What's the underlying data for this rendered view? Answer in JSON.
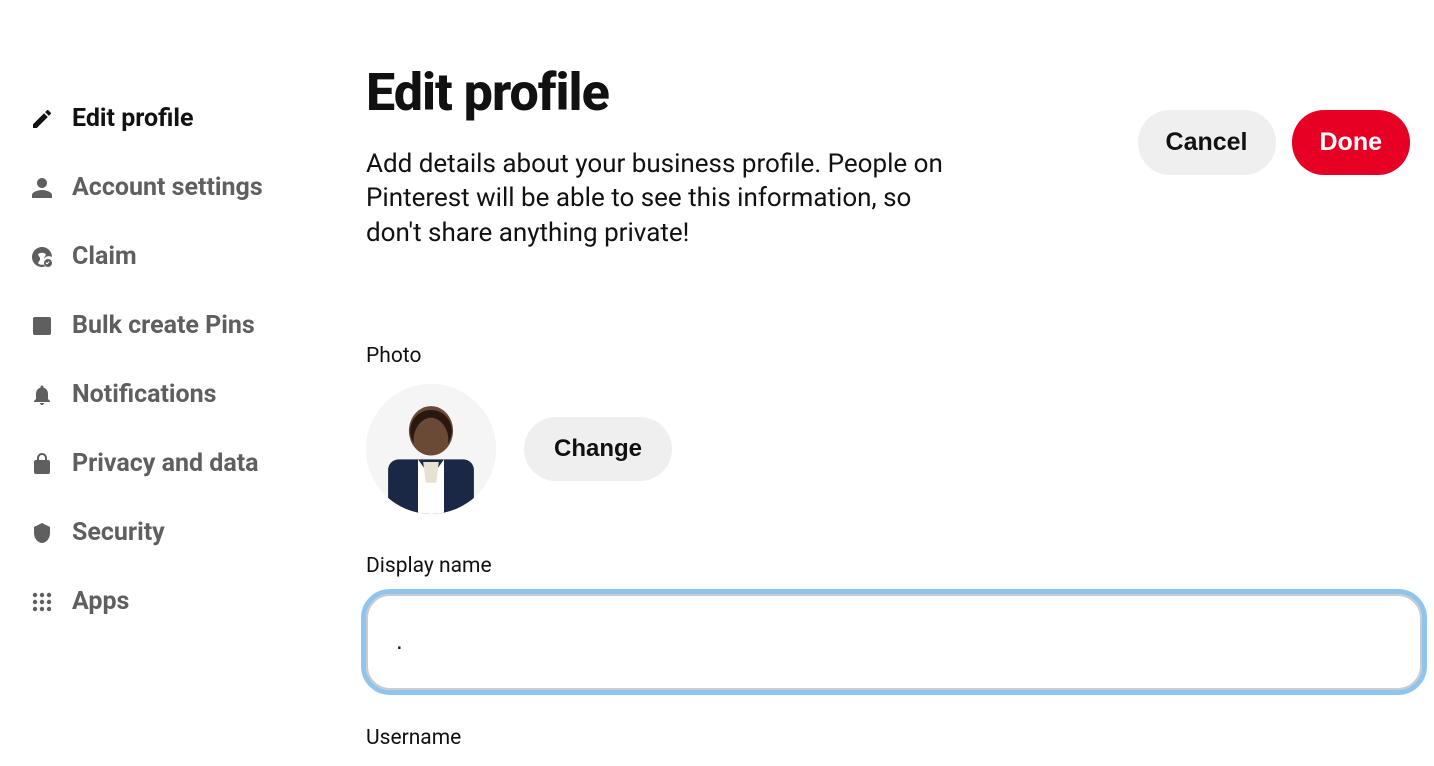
{
  "sidebar": {
    "items": [
      {
        "label": "Edit profile"
      },
      {
        "label": "Account settings"
      },
      {
        "label": "Claim"
      },
      {
        "label": "Bulk create Pins"
      },
      {
        "label": "Notifications"
      },
      {
        "label": "Privacy and data"
      },
      {
        "label": "Security"
      },
      {
        "label": "Apps"
      }
    ]
  },
  "header": {
    "title": "Edit profile",
    "description": "Add details about your business profile. People on Pinterest will be able to see this information, so don't share anything private!"
  },
  "photo": {
    "label": "Photo",
    "change_label": "Change"
  },
  "display_name": {
    "label": "Display name",
    "value": "."
  },
  "username": {
    "label": "Username"
  },
  "actions": {
    "cancel": "Cancel",
    "done": "Done"
  }
}
